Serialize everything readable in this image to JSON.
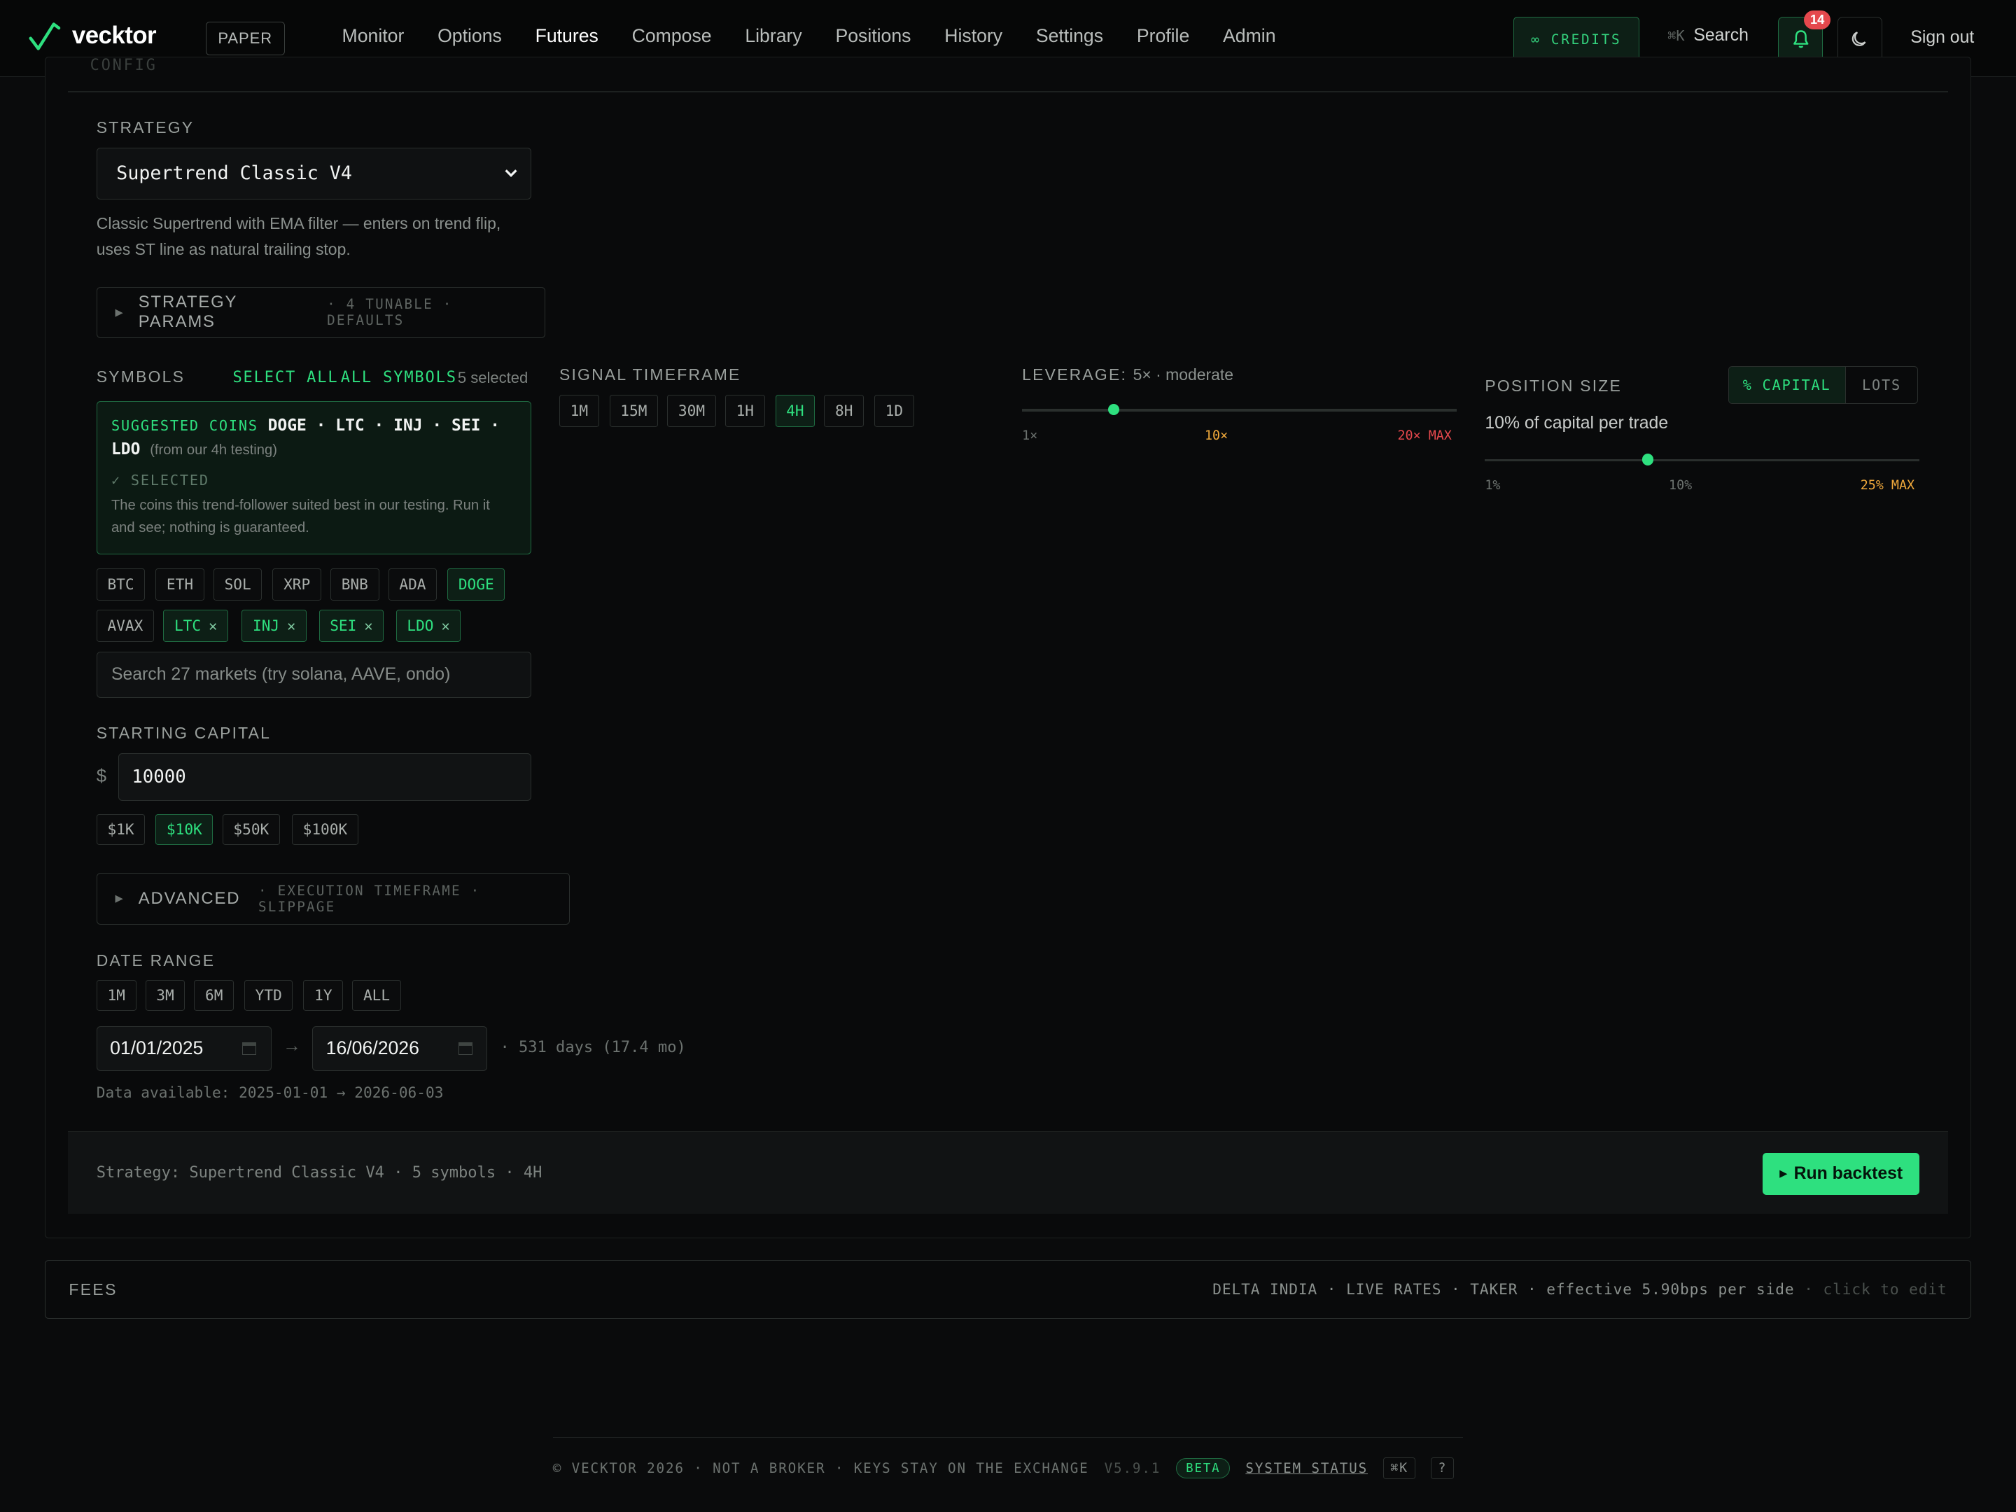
{
  "nav": {
    "brand": "vecktor",
    "mode_badge": "PAPER",
    "links": [
      "Monitor",
      "Options",
      "Futures",
      "Compose",
      "Library",
      "Positions",
      "History",
      "Settings",
      "Profile",
      "Admin"
    ],
    "active_link": "Futures",
    "credits": "∞ CREDITS",
    "search_kbd": "⌘K",
    "search_label": "Search",
    "notification_count": "14",
    "signout": "Sign out"
  },
  "config": {
    "label": "CONFIG",
    "strategy_label": "STRATEGY",
    "strategy_value": "Supertrend Classic V4",
    "strategy_desc": "Classic Supertrend with EMA filter — enters on trend flip, uses ST line as natural trailing stop.",
    "params": {
      "title": "STRATEGY PARAMS",
      "meta": "· 4 TUNABLE · DEFAULTS"
    },
    "symbols": {
      "label": "SYMBOLS",
      "select_all": "SELECT ALL",
      "all_symbols": "ALL SYMBOLS",
      "selected_count": "5 selected",
      "suggested_label": "SUGGESTED COINS",
      "suggested_coins": "DOGE · LTC · INJ · SEI · LDO",
      "suggested_note": "(from our 4h testing)",
      "selected_tag": "✓ SELECTED",
      "suggested_desc": "The coins this trend-follower suited best in our testing. Run it and see; nothing is guaranteed.",
      "row1": [
        {
          "label": "BTC",
          "on": false
        },
        {
          "label": "ETH",
          "on": false
        },
        {
          "label": "SOL",
          "on": false
        },
        {
          "label": "XRP",
          "on": false
        },
        {
          "label": "BNB",
          "on": false
        },
        {
          "label": "ADA",
          "on": false
        },
        {
          "label": "DOGE",
          "on": true
        }
      ],
      "row2": [
        {
          "label": "AVAX",
          "on": false
        },
        {
          "label": "LTC",
          "on": true
        },
        {
          "label": "INJ",
          "on": true
        },
        {
          "label": "SEI",
          "on": true
        },
        {
          "label": "LDO",
          "on": true
        }
      ],
      "search_placeholder": "Search 27 markets (try solana, AAVE, ondo)"
    },
    "capital": {
      "label": "STARTING CAPITAL",
      "currency": "$",
      "value": "10000",
      "presets": [
        "$1K",
        "$10K",
        "$50K",
        "$100K"
      ],
      "active_preset": "$10K"
    },
    "advanced": {
      "title": "ADVANCED",
      "meta": "· EXECUTION TIMEFRAME · SLIPPAGE"
    },
    "date_range": {
      "label": "DATE RANGE",
      "presets": [
        "1M",
        "3M",
        "6M",
        "YTD",
        "1Y",
        "ALL"
      ],
      "start": "01/01/2025",
      "arrow": "→",
      "end": "16/06/2026",
      "span": "· 531 days (17.4 mo)",
      "available": "Data available: 2025-01-01 → 2026-06-03"
    },
    "timeframe": {
      "label": "SIGNAL TIMEFRAME",
      "options": [
        "1M",
        "15M",
        "30M",
        "1H",
        "4H",
        "8H",
        "1D"
      ],
      "active": "4H"
    },
    "leverage": {
      "label": "LEVERAGE:",
      "value_text": "5× · moderate",
      "value": 5,
      "min": 1,
      "max": 20,
      "tick_min": "1×",
      "tick_mid": "10×",
      "tick_max": "20× MAX"
    },
    "position_size": {
      "label": "POSITION SIZE",
      "mode_on": "% CAPITAL",
      "mode_off": "LOTS",
      "summary": "10% of capital per trade",
      "value": 10,
      "min": 1,
      "max": 25,
      "tick_min": "1%",
      "tick_mid": "10%",
      "tick_max": "25% MAX"
    },
    "summary": "Strategy: Supertrend Classic V4 · 5 symbols · 4H",
    "run_label": "Run backtest"
  },
  "fees": {
    "label": "FEES",
    "detail": "DELTA INDIA · LIVE RATES · TAKER · effective 5.90bps per side",
    "hint": "· click to edit"
  },
  "footer": {
    "text": "© VECKTOR 2026 · NOT A BROKER · KEYS STAY ON THE EXCHANGE",
    "version": "V5.9.1",
    "beta": "BETA",
    "status": "SYSTEM STATUS",
    "kbd": "⌘K",
    "help": "?"
  },
  "colors": {
    "accent": "#2ee07f",
    "warn": "#f0a93b",
    "danger": "#e5484d",
    "bg": "#0a0b0c"
  }
}
